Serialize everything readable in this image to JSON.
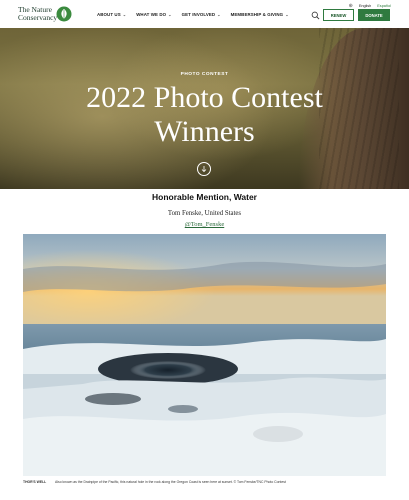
{
  "header": {
    "logo_line1": "The Nature",
    "logo_line2": "Conservancy",
    "nav": [
      {
        "label": "ABOUT US"
      },
      {
        "label": "WHAT WE DO"
      },
      {
        "label": "GET INVOLVED"
      },
      {
        "label": "MEMBERSHIP & GIVING"
      }
    ],
    "lang_active": "English",
    "lang_other": "Español",
    "renew_label": "RENEW",
    "donate_label": "DONATE"
  },
  "hero": {
    "kicker": "PHOTO CONTEST",
    "title": "2022 Photo Contest Winners"
  },
  "content": {
    "award": "Honorable Mention, Water",
    "author": "Tom Fenske, United States",
    "handle": "@Tom_Fenske",
    "caption_title": "THOR'S WELL",
    "caption_text": "Also known as the Drainpipe of the Pacific, this natural hole in the rock along the Oregon Coast is seen here at sunset. © Tom Fenske/TNC Photo Contest"
  },
  "colors": {
    "brand_green": "#2f7a3f",
    "link_green": "#2a6a3a"
  }
}
